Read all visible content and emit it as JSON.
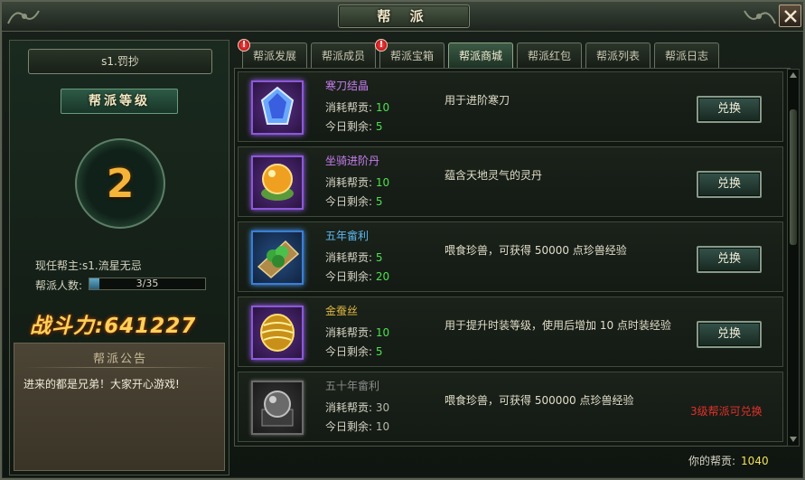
{
  "window": {
    "title": "帮 派"
  },
  "guild": {
    "name": "s1.罚抄",
    "level_label": "帮派等级",
    "level": "2",
    "leader_label": "现任帮主:",
    "leader_name": "s1.流星无忌",
    "members_label": "帮派人数:",
    "members_text": "3/35",
    "members_fraction": 0.0857,
    "power_text": "战斗力:641227",
    "notice_title": "帮派公告",
    "notice_text": "进来的都是兄弟！大家开心游戏!"
  },
  "tabs": [
    {
      "label": "帮派发展",
      "alert": "!"
    },
    {
      "label": "帮派成员",
      "alert": ""
    },
    {
      "label": "帮派宝箱",
      "alert": "!"
    },
    {
      "label": "帮派商城",
      "alert": "",
      "active": true
    },
    {
      "label": "帮派红包",
      "alert": ""
    },
    {
      "label": "帮派列表",
      "alert": ""
    },
    {
      "label": "帮派日志",
      "alert": ""
    }
  ],
  "shop": {
    "cost_label": "消耗帮贡:",
    "left_label": "今日剩余:",
    "exchange_label": "兑换",
    "items": [
      {
        "name": "寒刀结晶",
        "cost": "10",
        "left": "5",
        "desc": "用于进阶寒刀",
        "icon": "crystal-icon",
        "action": "兑换"
      },
      {
        "name": "坐骑进阶丹",
        "cost": "10",
        "left": "5",
        "desc": "蕴含天地灵气的灵丹",
        "icon": "pill-icon",
        "action": "兑换"
      },
      {
        "name": "五年畲利",
        "cost": "5",
        "left": "20",
        "desc": "喂食珍兽，可获得 50000 点珍兽经验",
        "icon": "fruit-icon",
        "action": "兑换"
      },
      {
        "name": "金蚕丝",
        "cost": "10",
        "left": "5",
        "desc": "用于提升时装等级，使用后增加 10 点时装经验",
        "icon": "silk-icon",
        "action": "兑换"
      },
      {
        "name": "五十年畲利",
        "cost": "30",
        "left": "10",
        "desc": "喂食珍兽，可获得 500000 点珍兽经验",
        "icon": "orb-icon",
        "action": "",
        "requirement": "3级帮派可兑换"
      }
    ]
  },
  "footer": {
    "contribution_label": "你的帮贡:",
    "contribution_value": "1040"
  },
  "colors": {
    "accent_gold": "#f4b43a",
    "value_green": "#4ee04e",
    "requirement_red": "#e0302a",
    "epic_purple": "#c77cf0",
    "rare_blue": "#5cb8f0"
  }
}
